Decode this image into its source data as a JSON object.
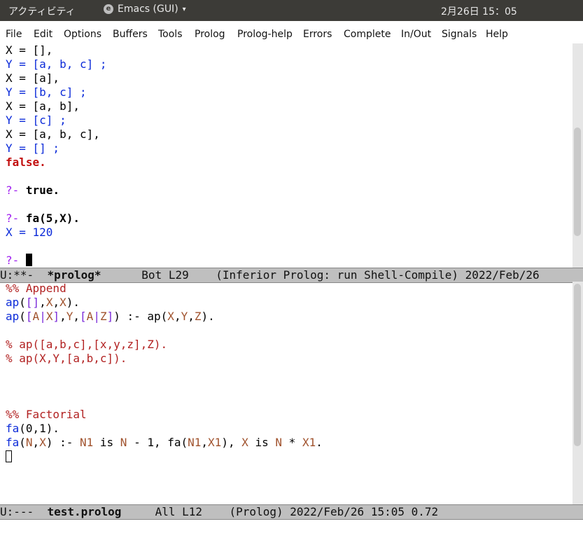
{
  "topbar": {
    "activities": "アクティビティ",
    "app_name": "Emacs (GUI)",
    "app_arrow": "▾",
    "clock": "2月26日  15：05"
  },
  "menu": [
    "File",
    "Edit",
    "Options",
    "Buffers",
    "Tools",
    "Prolog",
    "Prolog-help",
    "Errors",
    "Complete",
    "In/Out",
    "Signals",
    "Help"
  ],
  "prolog_buffer": {
    "lines": [
      [
        {
          "t": "X = [],",
          "c": ""
        }
      ],
      [
        {
          "t": "Y = [a, b, c] ;",
          "c": "var"
        }
      ],
      [
        {
          "t": "X = [a],",
          "c": ""
        }
      ],
      [
        {
          "t": "Y = [b, c] ;",
          "c": "var"
        }
      ],
      [
        {
          "t": "X = [a, b],",
          "c": ""
        }
      ],
      [
        {
          "t": "Y = [c] ;",
          "c": "var"
        }
      ],
      [
        {
          "t": "X = [a, b, c],",
          "c": ""
        }
      ],
      [
        {
          "t": "Y = [] ;",
          "c": "var"
        }
      ],
      [
        {
          "t": "false.",
          "c": "red"
        }
      ],
      [
        {
          "t": "",
          "c": ""
        }
      ],
      [
        {
          "t": "?- ",
          "c": "prompt"
        },
        {
          "t": "true.",
          "c": "bold"
        }
      ],
      [
        {
          "t": "",
          "c": ""
        }
      ],
      [
        {
          "t": "?- ",
          "c": "prompt"
        },
        {
          "t": "fa(5,X).",
          "c": "bold"
        }
      ],
      [
        {
          "t": "X = 120",
          "c": "var"
        }
      ],
      [
        {
          "t": "",
          "c": ""
        }
      ],
      [
        {
          "t": "?- ",
          "c": "prompt"
        }
      ]
    ]
  },
  "modeline1": {
    "status": "U:**-  ",
    "buffer": "*prolog*",
    "rest": "      Bot L29    (Inferior Prolog: run Shell-Compile) 2022/Feb/26"
  },
  "file_buffer": {
    "lines": [
      [
        {
          "t": "%% Append",
          "c": "cmt"
        }
      ],
      [
        {
          "t": "ap",
          "c": "fn"
        },
        {
          "t": "(",
          "c": ""
        },
        {
          "t": "[]",
          "c": "ws"
        },
        {
          "t": ",",
          "c": ""
        },
        {
          "t": "X",
          "c": "lv"
        },
        {
          "t": ",",
          "c": ""
        },
        {
          "t": "X",
          "c": "lv"
        },
        {
          "t": ").",
          "c": ""
        }
      ],
      [
        {
          "t": "ap",
          "c": "fn"
        },
        {
          "t": "(",
          "c": ""
        },
        {
          "t": "[",
          "c": "ws"
        },
        {
          "t": "A",
          "c": "lv"
        },
        {
          "t": "|",
          "c": "ws"
        },
        {
          "t": "X",
          "c": "lv"
        },
        {
          "t": "]",
          "c": "ws"
        },
        {
          "t": ",",
          "c": ""
        },
        {
          "t": "Y",
          "c": "lv"
        },
        {
          "t": ",",
          "c": ""
        },
        {
          "t": "[",
          "c": "ws"
        },
        {
          "t": "A",
          "c": "lv"
        },
        {
          "t": "|",
          "c": "ws"
        },
        {
          "t": "Z",
          "c": "lv"
        },
        {
          "t": "]",
          "c": "ws"
        },
        {
          "t": ") :- ap(",
          "c": ""
        },
        {
          "t": "X",
          "c": "lv"
        },
        {
          "t": ",",
          "c": ""
        },
        {
          "t": "Y",
          "c": "lv"
        },
        {
          "t": ",",
          "c": ""
        },
        {
          "t": "Z",
          "c": "lv"
        },
        {
          "t": ").",
          "c": ""
        }
      ],
      [
        {
          "t": "",
          "c": ""
        }
      ],
      [
        {
          "t": "% ap([a,b,c],[x,y,z],Z).",
          "c": "cmt"
        }
      ],
      [
        {
          "t": "% ap(X,Y,[a,b,c]).",
          "c": "cmt"
        }
      ],
      [
        {
          "t": "",
          "c": ""
        }
      ],
      [
        {
          "t": "",
          "c": ""
        }
      ],
      [
        {
          "t": "",
          "c": ""
        }
      ],
      [
        {
          "t": "%% Factorial",
          "c": "cmt"
        }
      ],
      [
        {
          "t": "fa",
          "c": "fn"
        },
        {
          "t": "(0,1).",
          "c": ""
        }
      ],
      [
        {
          "t": "fa",
          "c": "fn"
        },
        {
          "t": "(",
          "c": ""
        },
        {
          "t": "N",
          "c": "lv"
        },
        {
          "t": ",",
          "c": ""
        },
        {
          "t": "X",
          "c": "lv"
        },
        {
          "t": ") :- ",
          "c": ""
        },
        {
          "t": "N1",
          "c": "lv"
        },
        {
          "t": " is ",
          "c": ""
        },
        {
          "t": "N",
          "c": "lv"
        },
        {
          "t": " - 1, fa(",
          "c": ""
        },
        {
          "t": "N1",
          "c": "lv"
        },
        {
          "t": ",",
          "c": ""
        },
        {
          "t": "X1",
          "c": "lv"
        },
        {
          "t": "), ",
          "c": ""
        },
        {
          "t": "X",
          "c": "lv"
        },
        {
          "t": " is ",
          "c": ""
        },
        {
          "t": "N",
          "c": "lv"
        },
        {
          "t": " * ",
          "c": ""
        },
        {
          "t": "X1",
          "c": "lv"
        },
        {
          "t": ".",
          "c": ""
        }
      ],
      [
        {
          "t": "",
          "c": ""
        }
      ]
    ]
  },
  "modeline2": {
    "status": "U:---  ",
    "buffer": "test.prolog",
    "rest": "     All L12    (Prolog) 2022/Feb/26 15:05 0.72"
  }
}
